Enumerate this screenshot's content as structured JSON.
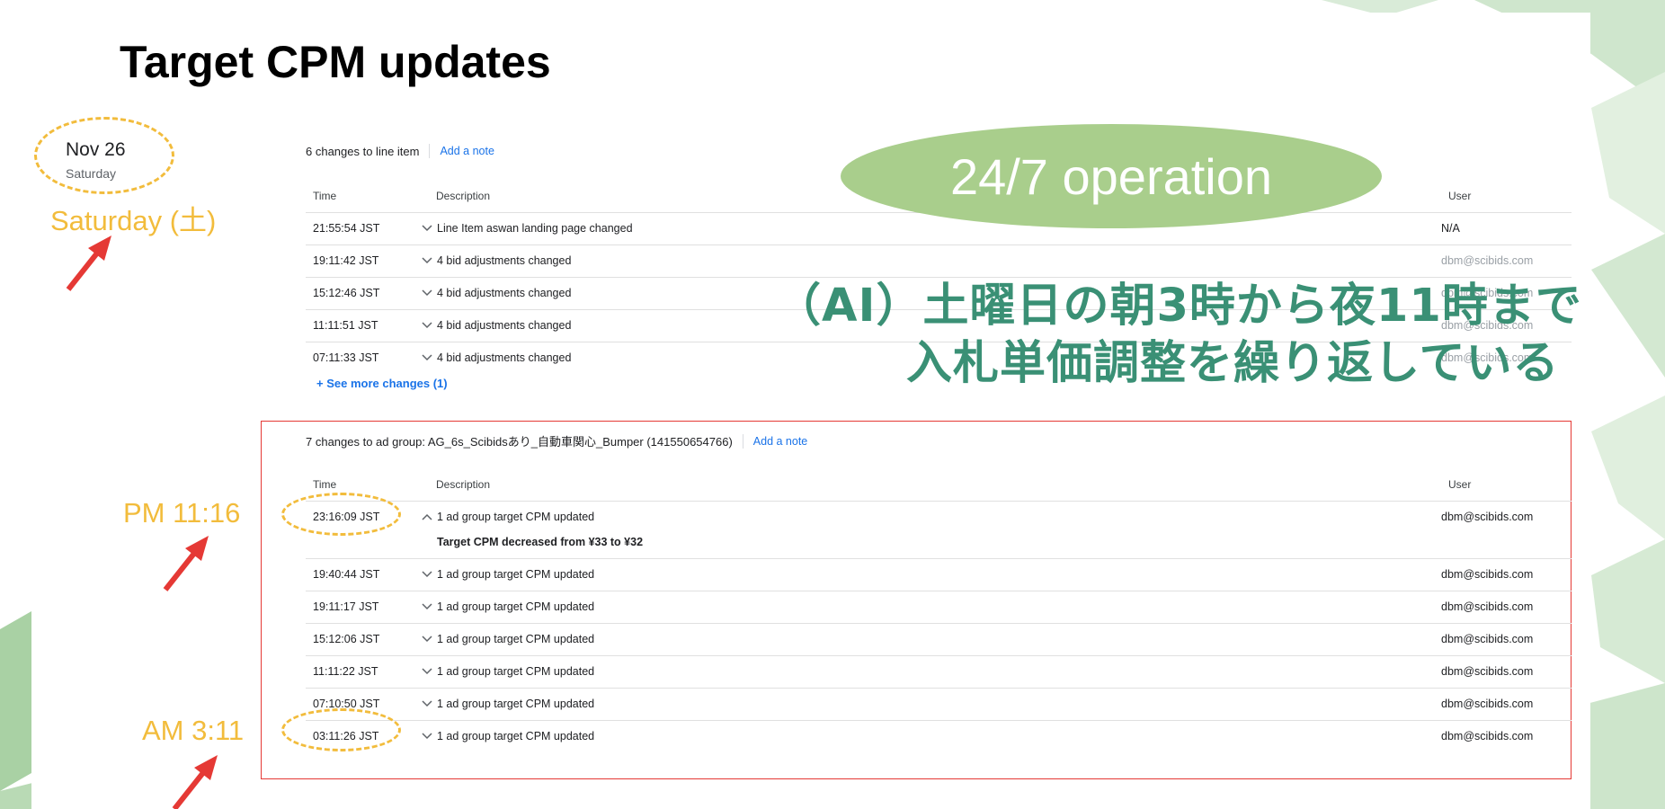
{
  "title": "Target CPM updates",
  "date_annotation": {
    "date": "Nov 26",
    "weekday": "Saturday",
    "callout": "Saturday (土)"
  },
  "line_item_panel": {
    "header": "6 changes to line item",
    "add_note": "Add a note",
    "columns": {
      "time": "Time",
      "description": "Description",
      "user": "User"
    },
    "rows": [
      {
        "time": "21:55:54 JST",
        "description": "Line Item aswan landing page changed",
        "user": "N/A"
      },
      {
        "time": "19:11:42 JST",
        "description": "4 bid adjustments changed",
        "user": "dbm@scibids.com"
      },
      {
        "time": "15:12:46 JST",
        "description": "4 bid adjustments changed",
        "user": "dbm@scibids.com"
      },
      {
        "time": "11:11:51 JST",
        "description": "4 bid adjustments changed",
        "user": "dbm@scibids.com"
      },
      {
        "time": "07:11:33 JST",
        "description": "4 bid adjustments changed",
        "user": "dbm@scibids.com"
      }
    ],
    "see_more": "+ See more changes (1)"
  },
  "ad_group_panel": {
    "header": "7 changes to ad group: AG_6s_Scibidsあり_自動車関心_Bumper (141550654766)",
    "add_note": "Add a note",
    "columns": {
      "time": "Time",
      "description": "Description",
      "user": "User"
    },
    "rows": [
      {
        "time": "23:16:09 JST",
        "description": "1 ad group target CPM updated",
        "user": "dbm@scibids.com",
        "detail": "Target CPM decreased from ¥33 to ¥32"
      },
      {
        "time": "19:40:44 JST",
        "description": "1 ad group target CPM updated",
        "user": "dbm@scibids.com"
      },
      {
        "time": "19:11:17 JST",
        "description": "1 ad group target CPM updated",
        "user": "dbm@scibids.com"
      },
      {
        "time": "15:12:06 JST",
        "description": "1 ad group target CPM updated",
        "user": "dbm@scibids.com"
      },
      {
        "time": "11:11:22 JST",
        "description": "1 ad group target CPM updated",
        "user": "dbm@scibids.com"
      },
      {
        "time": "07:10:50 JST",
        "description": "1 ad group target CPM updated",
        "user": "dbm@scibids.com"
      },
      {
        "time": "03:11:26 JST",
        "description": "1 ad group target CPM updated",
        "user": "dbm@scibids.com"
      }
    ]
  },
  "callouts": {
    "operation": "24/7 operation",
    "jp_line1": "（AI）土曜日の朝3時から夜11時まで",
    "jp_line2": "入札単価調整を繰り返している",
    "pm": "PM 11:16",
    "am": "AM 3:11"
  },
  "colors": {
    "accent_yellow": "#f2bc3c",
    "green_callout": "#a9ce8c",
    "jp_text": "#3a9075",
    "link_blue": "#1a73e8",
    "highlight_red": "#e53935"
  }
}
